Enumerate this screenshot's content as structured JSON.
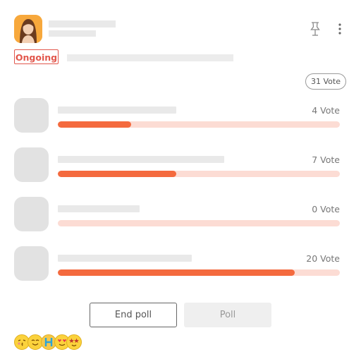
{
  "header": {
    "avatar_icon": "user-avatar",
    "pin_icon": "pin-icon",
    "more_icon": "more-vertical-icon"
  },
  "poll": {
    "status": "Ongoing",
    "total_votes_label": "31 Vote",
    "accent_color": "#f46a3e",
    "track_color": "#fcdcd4",
    "options": [
      {
        "votes_label": "4 Vote",
        "fraction": 0.26
      },
      {
        "votes_label": "7 Vote",
        "fraction": 0.42
      },
      {
        "votes_label": "0 Vote",
        "fraction": 0.0
      },
      {
        "votes_label": "20 Vote",
        "fraction": 0.84
      }
    ]
  },
  "actions": {
    "end_poll_label": "End poll",
    "poll_label": "Poll"
  },
  "reactions": {
    "icons": [
      "kiss-emoji-icon",
      "smile-emoji-icon",
      "h-emoji-icon",
      "heart-eyes-emoji-icon",
      "star-eyes-emoji-icon"
    ]
  }
}
